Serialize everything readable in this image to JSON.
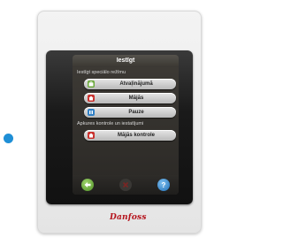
{
  "screen": {
    "title": "Iestīgt",
    "section1_label": "Iestīgt speciālo režīmu",
    "section2_label": "Apkures kontrole un iestatījumi",
    "mode_buttons": [
      {
        "label": "Atvaļinājumā",
        "icon": "suitcase-icon"
      },
      {
        "label": "Mājās",
        "icon": "house-icon"
      },
      {
        "label": "Pauze",
        "icon": "pause-icon"
      }
    ],
    "control_button": {
      "label": "Mājās kontrole",
      "icon": "house-icon"
    },
    "bottom_icons": [
      "back-arrow-icon",
      "cancel-x-icon",
      "help-icon"
    ],
    "help_glyph": "?"
  },
  "brand": {
    "logo_text": "Danfoss",
    "accent": "#b5121b"
  },
  "colors": {
    "indicator": "#1f8fd6"
  }
}
